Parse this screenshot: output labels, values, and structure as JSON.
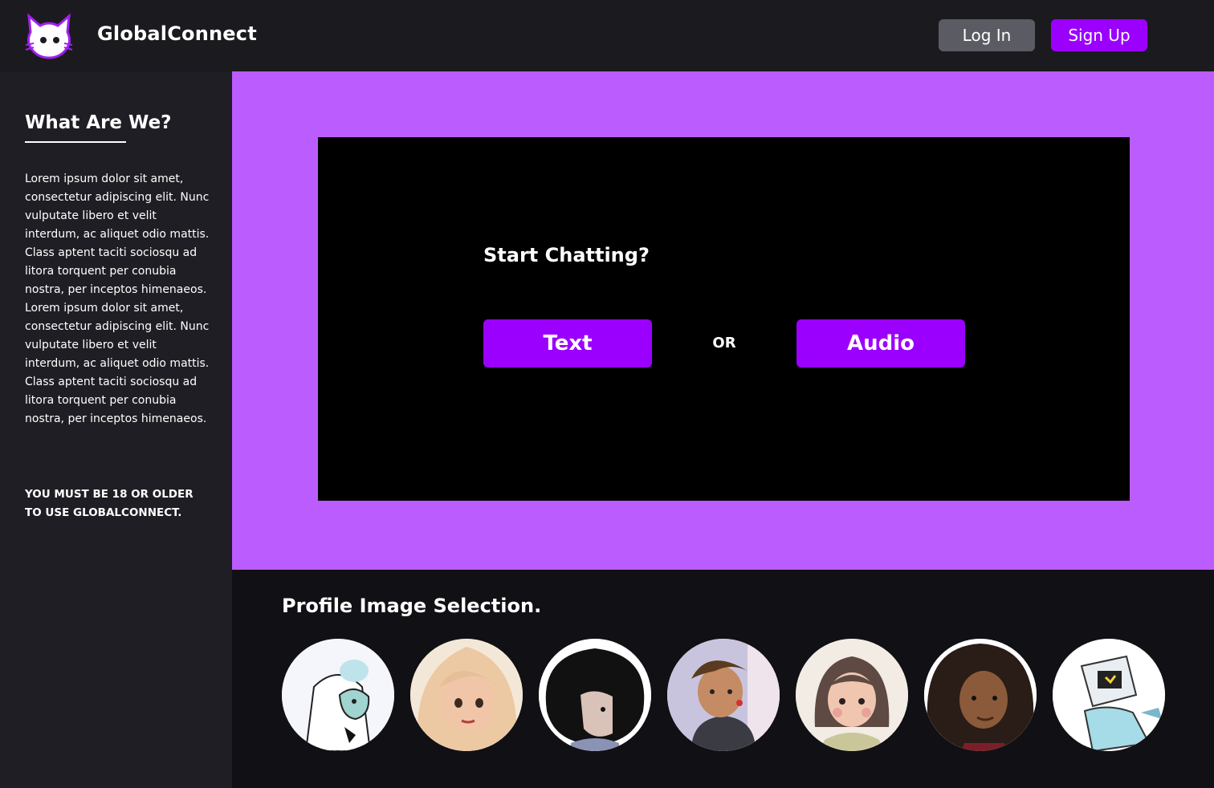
{
  "header": {
    "brand": "GlobalConnect",
    "login_label": "Log In",
    "signup_label": "Sign Up"
  },
  "sidebar": {
    "title": "What Are We?",
    "body": "Lorem ipsum dolor sit amet, consectetur adipiscing elit. Nunc vulputate libero et velit interdum, ac aliquet odio mattis. Class aptent taciti sociosqu ad litora torquent per conubia nostra, per inceptos himenaeos. Lorem ipsum dolor sit amet, consectetur adipiscing elit. Nunc vulputate libero et velit interdum, ac aliquet odio mattis. Class aptent taciti sociosqu ad litora torquent per conubia nostra, per inceptos himenaeos.",
    "warning": "YOU MUST BE 18 OR OLDER TO USE GLOBALCONNECT."
  },
  "chat": {
    "title": "Start Chatting?",
    "text_button": "Text",
    "or_label": "OR",
    "audio_button": "Audio"
  },
  "profiles": {
    "title": "Profile Image Selection."
  },
  "colors": {
    "accent": "#9b00ff",
    "hero_bg": "#bb5cff",
    "header_bg": "#1b1a1e",
    "sidebar_bg": "#1f1e24",
    "login_bg": "#5b5b63"
  },
  "icons": {
    "logo": "cat-logo-icon"
  }
}
